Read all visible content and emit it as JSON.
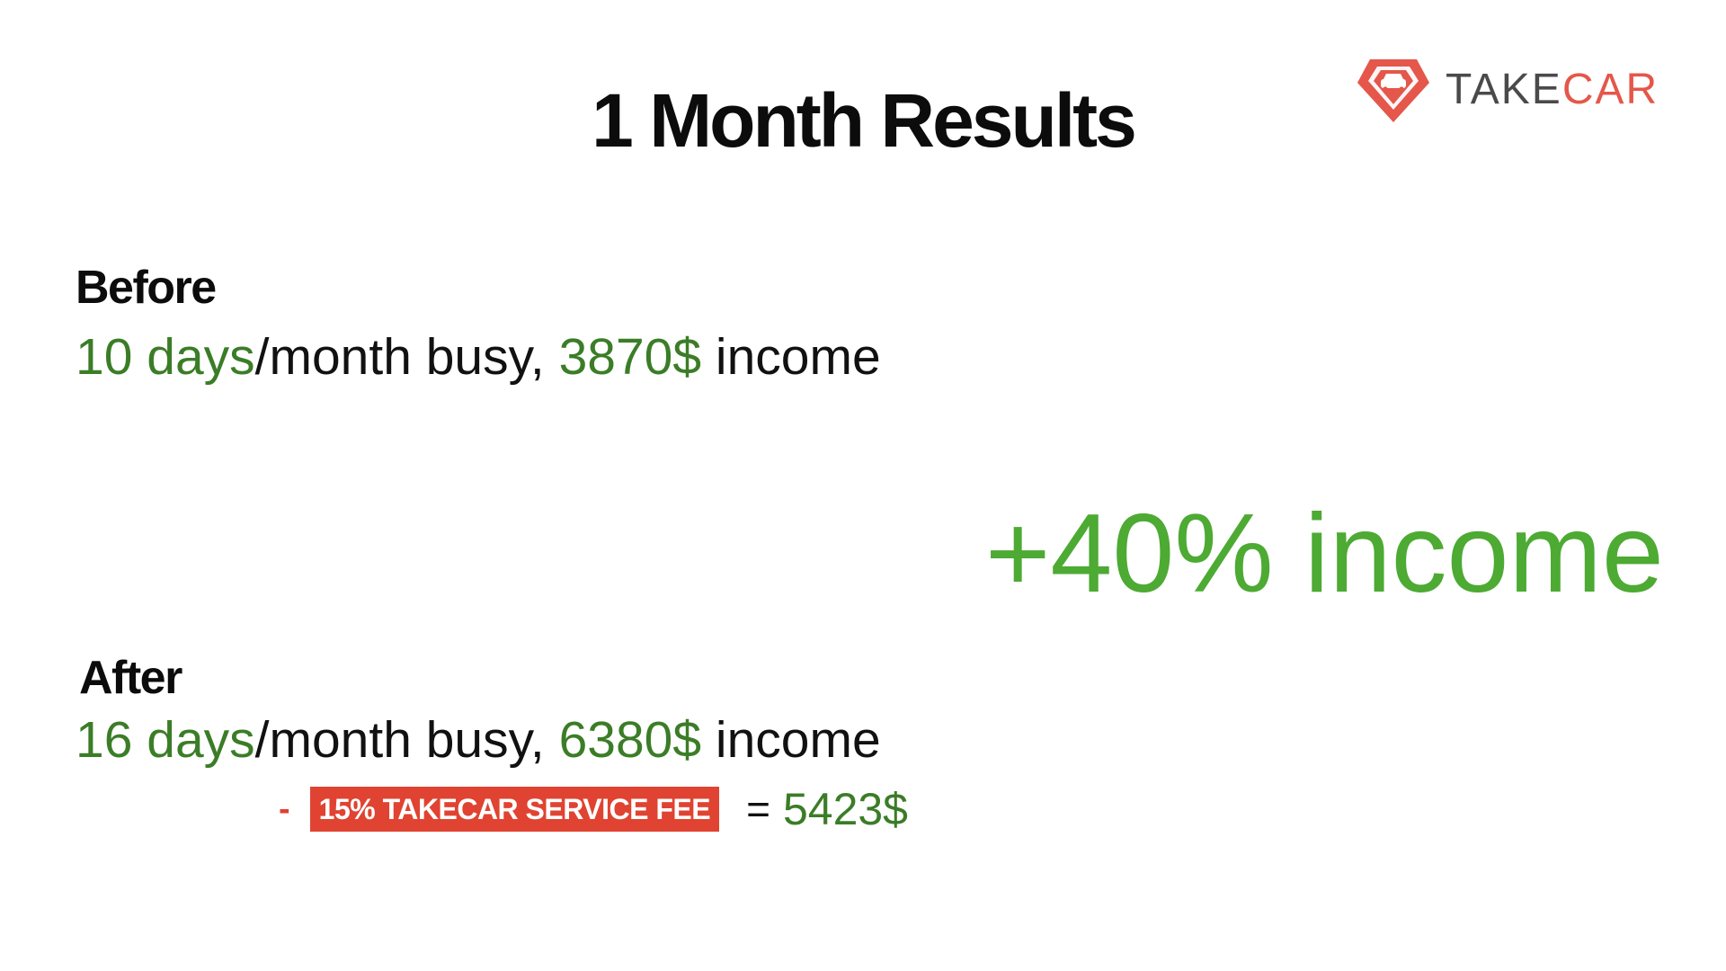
{
  "slide": {
    "title": "1 Month Results"
  },
  "logo": {
    "icon": "takecar-car-diamond-icon",
    "text_prefix": "TAKE",
    "text_suffix": "CAR",
    "brand_color": "#e4574a",
    "text_color": "#4a4a4a"
  },
  "before": {
    "label": "Before",
    "days": "10 days",
    "middle": "/month busy, ",
    "income": "3870$",
    "suffix": " income"
  },
  "highlight": {
    "text": "+40% income",
    "color": "#4daa33"
  },
  "after": {
    "label": "After",
    "days": "16 days",
    "middle": "/month busy, ",
    "income": "6380$",
    "suffix": " income"
  },
  "fee": {
    "minus": "-",
    "badge": "15% TAKECAR SERVICE FEE",
    "equals": "=",
    "total": "5423$",
    "badge_color": "#e04331"
  },
  "colors": {
    "green_text": "#3b7d27",
    "black_text": "#0c0c0c"
  }
}
